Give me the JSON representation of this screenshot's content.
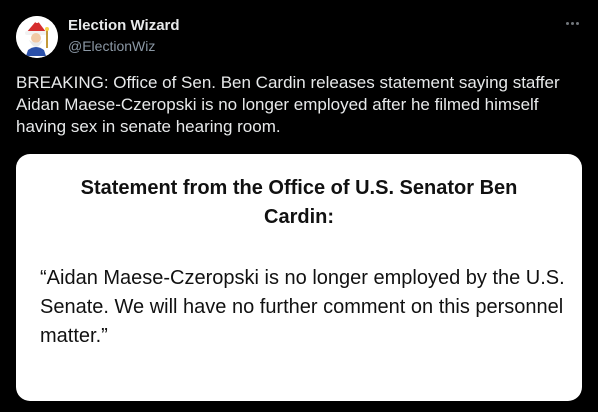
{
  "tweet": {
    "author_name": "Election Wizard",
    "author_handle": "@ElectionWiz",
    "text": "BREAKING: Office of Sen. Ben Cardin releases statement saying staffer Aidan Maese-Czeropski is no longer employed after he filmed himself having sex in senate hearing room.",
    "avatar_icon": "wizard-icon",
    "more_icon": "more-options-icon"
  },
  "media": {
    "title": "Statement from the Office of U.S. Senator Ben Cardin:",
    "body": "“Aidan Maese-Czeropski is no longer employed by the U.S. Senate.  We will have no further comment on this personnel matter.”"
  },
  "colors": {
    "background": "#000000",
    "primary_text": "#e7e9ea",
    "secondary_text": "#8b98a5",
    "card_background": "#ffffff"
  }
}
